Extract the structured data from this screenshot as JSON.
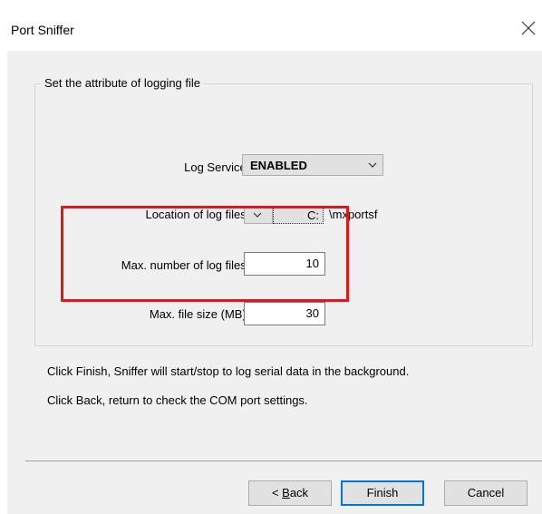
{
  "window": {
    "title": "Port Sniffer"
  },
  "group": {
    "legend": "Set the attribute of logging file",
    "log_service": {
      "label": "Log Service :",
      "value": "ENABLED"
    },
    "location": {
      "label": "Location of log files :",
      "drive": "C:",
      "path": "\\mxportsf"
    },
    "max_files": {
      "label": "Max. number of log files :",
      "value": "10"
    },
    "max_size": {
      "label": "Max. file size (MB) :",
      "value": "30"
    }
  },
  "info": {
    "line1": "Click Finish, Sniffer will start/stop to log serial data in the background.",
    "line2": "Click Back, return to check the COM port settings."
  },
  "buttons": {
    "back_prefix": "< ",
    "back_hotkey": "B",
    "back_rest": "ack",
    "finish": "Finish",
    "cancel": "Cancel"
  },
  "colors": {
    "highlight": "#e8141c",
    "dialog_bg": "#f0f0f0",
    "focus": "#0078d7"
  }
}
